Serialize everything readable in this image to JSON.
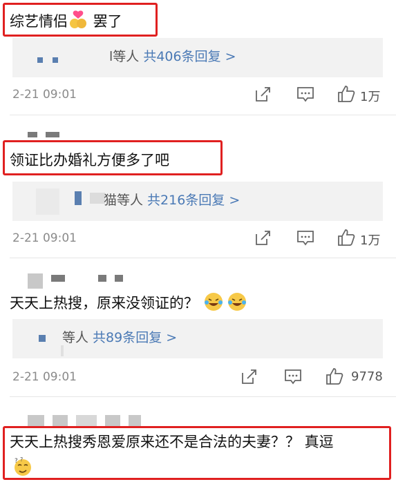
{
  "comments": [
    {
      "text": "综艺情侣",
      "text_after_emoji": " 罢了",
      "emoji": "couple-heart-emoji",
      "reply_text": "l等人 ",
      "reply_count": "共406条回复 >",
      "time": "2-21 09:01",
      "likes": "1万"
    },
    {
      "text": "领证比办婚礼方便多了吧",
      "reply_text": "猫等人 ",
      "reply_count": "共216条回复 >",
      "time": "2-21 09:01",
      "likes": "1万"
    },
    {
      "text": "天天上热搜，原来没领证的？",
      "emoji": "laughing-crying-emoji",
      "reply_text": "等人 ",
      "reply_count": "共89条回复 >",
      "time": "2-21 09:01",
      "likes": "9778"
    },
    {
      "text": "天天上热搜秀恩爱原来还不是合法的夫妻？？ 真逗",
      "emoji": "thinking-face-emoji"
    }
  ],
  "colors": {
    "highlight": "#e02020",
    "link": "#4a79b5",
    "reply_bg": "#f2f2f2",
    "meta": "#8a8a8a"
  },
  "icons": [
    "share-icon",
    "comment-icon",
    "like-icon"
  ]
}
